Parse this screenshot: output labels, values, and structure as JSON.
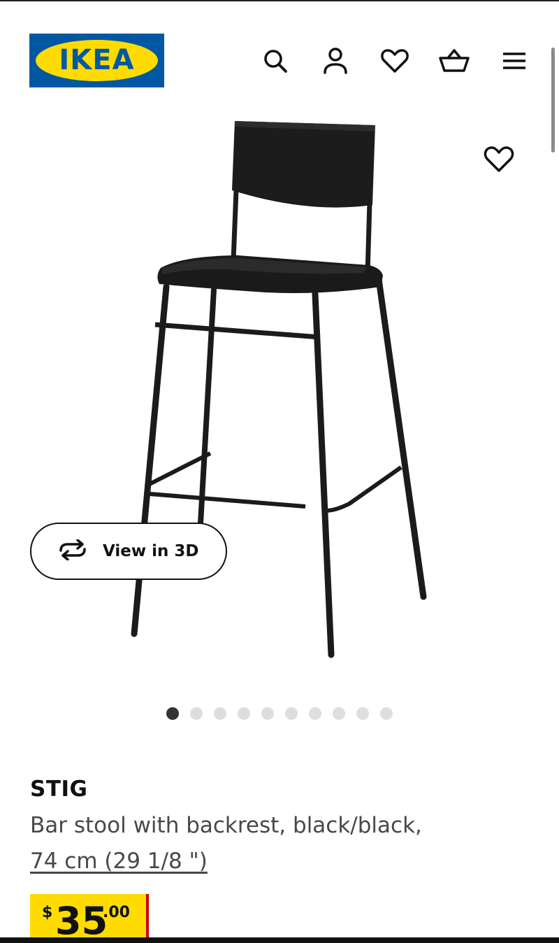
{
  "header": {
    "logo_text": "IKEA",
    "icons": [
      "search-icon",
      "profile-icon",
      "heart-icon",
      "basket-icon",
      "menu-icon"
    ]
  },
  "gallery": {
    "favorite_icon": "heart-icon",
    "view_3d_label": "View in 3D",
    "image_count": 10,
    "active_index": 0
  },
  "product": {
    "name": "STIG",
    "description_line1": "Bar stool with backrest, black/black,",
    "description_line2": "74 cm (29 1/8 \")",
    "price_currency": "$",
    "price_integer": "35",
    "price_decimal": ".00"
  },
  "colors": {
    "ikea_blue": "#0058a3",
    "ikea_yellow": "#ffdb00",
    "price_red": "#cc0008"
  }
}
